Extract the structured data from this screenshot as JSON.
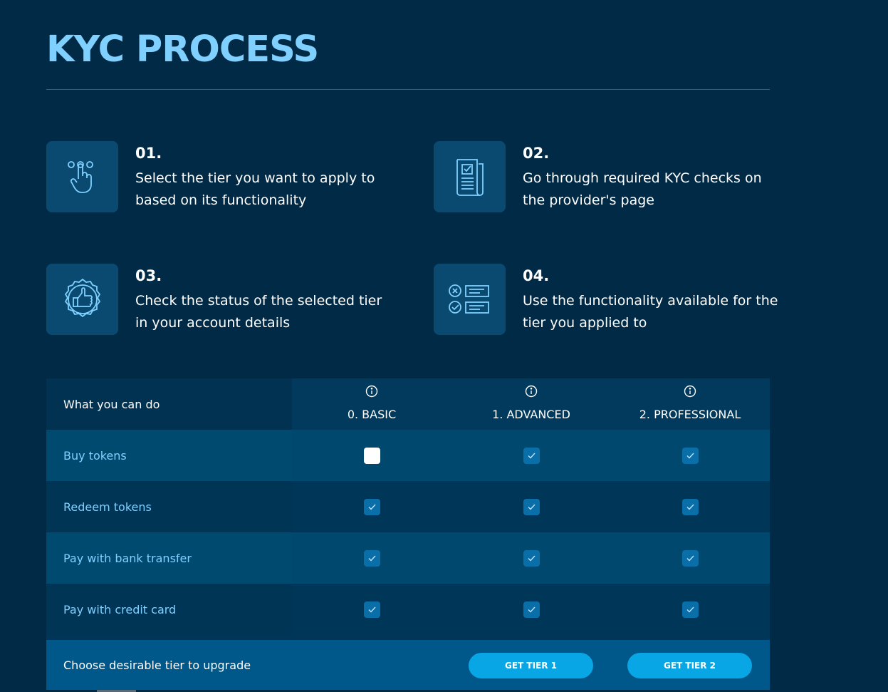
{
  "page": {
    "title": "KYC PROCESS"
  },
  "steps": [
    {
      "num": "01.",
      "text": "Select the tier you want to apply to based on its functionality",
      "icon": "hand-select-icon"
    },
    {
      "num": "02.",
      "text": "Go through required KYC checks on the provider's page",
      "icon": "document-check-icon"
    },
    {
      "num": "03.",
      "text": "Check the status of the selected tier in your account details",
      "icon": "thumbs-up-badge-icon"
    },
    {
      "num": "04.",
      "text": "Use the functionality available for the tier you applied to",
      "icon": "checklist-icon"
    }
  ],
  "table": {
    "header_label": "What you can do",
    "tiers": [
      "0. BASIC",
      "1. ADVANCED",
      "2. PROFESSIONAL"
    ],
    "rows": [
      {
        "label": "Buy tokens",
        "checks": [
          false,
          true,
          true
        ]
      },
      {
        "label": "Redeem tokens",
        "checks": [
          true,
          true,
          true
        ]
      },
      {
        "label": "Pay with bank transfer",
        "checks": [
          true,
          true,
          true
        ]
      },
      {
        "label": "Pay with credit card",
        "checks": [
          true,
          true,
          true
        ]
      }
    ],
    "footer_label": "Choose desirable tier to upgrade",
    "buttons": [
      "GET TIER 1",
      "GET TIER 2"
    ]
  },
  "colors": {
    "background": "#002a45",
    "title": "#7fd0ff",
    "accent_button": "#09a6e6",
    "check": "#0a6fa8"
  }
}
